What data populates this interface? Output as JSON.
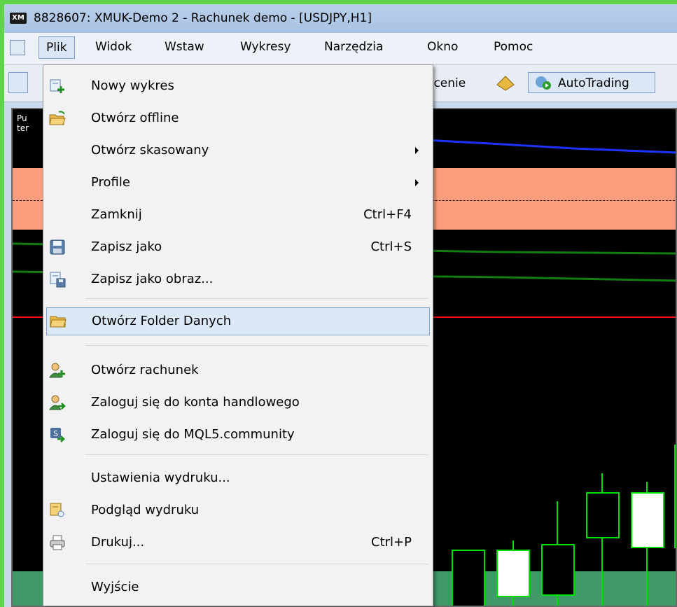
{
  "window": {
    "title": "8828607: XMUK-Demo 2 - Rachunek demo - [USDJPY,H1]",
    "logo_text": "XM"
  },
  "menubar": {
    "items": [
      {
        "label": "Plik"
      },
      {
        "label": "Widok"
      },
      {
        "label": "Wstaw"
      },
      {
        "label": "Wykresy"
      },
      {
        "label": "Narzędzia"
      },
      {
        "label": "Okno"
      },
      {
        "label": "Pomoc"
      }
    ]
  },
  "toolbar": {
    "order_label_fragment": "ecenie",
    "autotrading_label": "AutoTrading"
  },
  "chart": {
    "header_line1": "Pu",
    "header_line2": "ter"
  },
  "file_menu": {
    "items": [
      {
        "label": "Nowy wykres",
        "shortcut": "",
        "icon": "new-chart-icon"
      },
      {
        "label": "Otwórz offline",
        "shortcut": "",
        "icon": "open-folder-icon"
      },
      {
        "label": "Otwórz skasowany",
        "shortcut": "",
        "icon": "",
        "submenu": true
      },
      {
        "label": "Profile",
        "shortcut": "",
        "icon": "",
        "submenu": true
      },
      {
        "label": "Zamknij",
        "shortcut": "Ctrl+F4",
        "icon": ""
      },
      {
        "label": "Zapisz jako",
        "shortcut": "Ctrl+S",
        "icon": "save-disk-icon"
      },
      {
        "label": "Zapisz jako obraz...",
        "shortcut": "",
        "icon": "save-picture-icon"
      },
      {
        "label": "Otwórz Folder Danych",
        "shortcut": "",
        "icon": "folder-icon",
        "highlighted": true
      },
      {
        "label": "Otwórz rachunek",
        "shortcut": "",
        "icon": "user-add-icon"
      },
      {
        "label": "Zaloguj się do konta handlowego",
        "shortcut": "",
        "icon": "user-login-icon"
      },
      {
        "label": "Zaloguj się do MQL5.community",
        "shortcut": "",
        "icon": "mql5-login-icon"
      },
      {
        "label": "Ustawienia wydruku...",
        "shortcut": "",
        "icon": ""
      },
      {
        "label": "Podgląd wydruku",
        "shortcut": "",
        "icon": "print-preview-icon"
      },
      {
        "label": "Drukuj...",
        "shortcut": "Ctrl+P",
        "icon": "printer-icon"
      },
      {
        "label": "Wyjście",
        "shortcut": "",
        "icon": ""
      }
    ]
  },
  "colors": {
    "screen_border": "#5fd44a",
    "chart_background": "#000000",
    "zone": "#fa9d7c",
    "candle_outline": "#00e000",
    "menu_highlight": "#dbe8f6"
  }
}
